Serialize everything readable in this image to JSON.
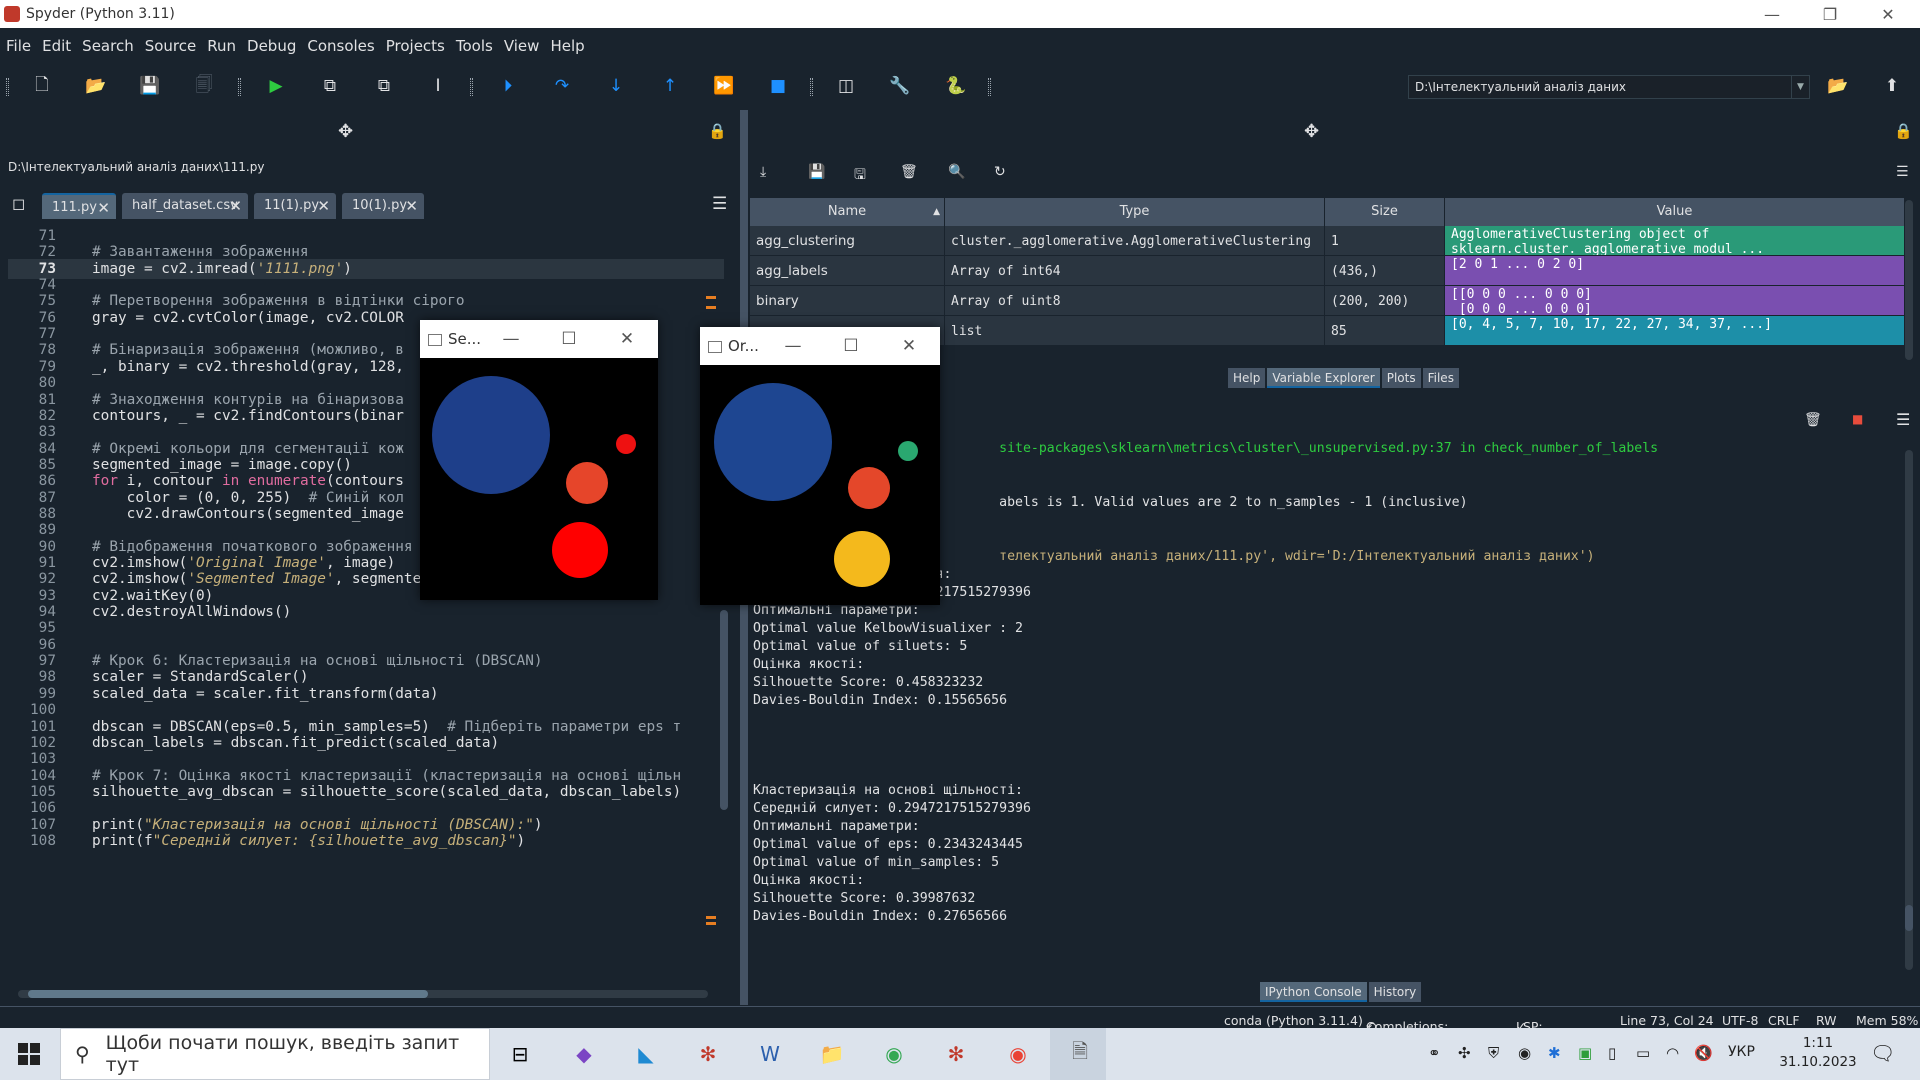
{
  "app": {
    "title": "Spyder (Python 3.11)"
  },
  "menu": [
    "File",
    "Edit",
    "Search",
    "Source",
    "Run",
    "Debug",
    "Consoles",
    "Projects",
    "Tools",
    "View",
    "Help"
  ],
  "toolbar": {
    "path": "D:\\Інтелектуальний аналіз даних"
  },
  "editor": {
    "file_path": "D:\\Інтелектуальний аналіз даних\\111.py",
    "tabs": [
      "111.py",
      "half_dataset.csv",
      "11(1).py",
      "10(1).py"
    ],
    "current_line": 73,
    "lines": [
      {
        "n": "71",
        "t": ""
      },
      {
        "n": "72",
        "t": "# Завантаження зображення"
      },
      {
        "n": "73",
        "t": "image = cv2.imread('1111.png')"
      },
      {
        "n": "74",
        "t": ""
      },
      {
        "n": "75",
        "t": "# Перетворення зображення в відтінки сірого"
      },
      {
        "n": "76",
        "t": "gray = cv2.cvtColor(image, cv2.COLOR"
      },
      {
        "n": "77",
        "t": ""
      },
      {
        "n": "78",
        "t": "# Бінаризація зображення (можливо, в                     ний п"
      },
      {
        "n": "79",
        "t": "_, binary = cv2.threshold(gray, 128,"
      },
      {
        "n": "80",
        "t": ""
      },
      {
        "n": "81",
        "t": "# Знаходження контурів на бінаризова"
      },
      {
        "n": "82",
        "t": "contours, _ = cv2.findContours(binar                      HAIN_"
      },
      {
        "n": "83",
        "t": ""
      },
      {
        "n": "84",
        "t": "# Окремі кольори для сегментації кож"
      },
      {
        "n": "85",
        "t": "segmented_image = image.copy()"
      },
      {
        "n": "86",
        "t": "for i, contour in enumerate(contours"
      },
      {
        "n": "87",
        "t": "    color = (0, 0, 255)  # Синій кол"
      },
      {
        "n": "88",
        "t": "    cv2.drawContours(segmented_image                      ckne"
      },
      {
        "n": "89",
        "t": ""
      },
      {
        "n": "90",
        "t": "# Відображення початкового зображення та зображення сегментації"
      },
      {
        "n": "91",
        "t": "cv2.imshow('Original Image', image)"
      },
      {
        "n": "92",
        "t": "cv2.imshow('Segmented Image', segmented_image)"
      },
      {
        "n": "93",
        "t": "cv2.waitKey(0)"
      },
      {
        "n": "94",
        "t": "cv2.destroyAllWindows()"
      },
      {
        "n": "95",
        "t": ""
      },
      {
        "n": "96",
        "t": ""
      },
      {
        "n": "97",
        "t": "# Крок 6: Кластеризація на основі щільності (DBSCAN)"
      },
      {
        "n": "98",
        "t": "scaler = StandardScaler()"
      },
      {
        "n": "99",
        "t": "scaled_data = scaler.fit_transform(data)"
      },
      {
        "n": "100",
        "t": ""
      },
      {
        "n": "101",
        "t": "dbscan = DBSCAN(eps=0.5, min_samples=5)  # Підберіть параметри eps т"
      },
      {
        "n": "102",
        "t": "dbscan_labels = dbscan.fit_predict(scaled_data)"
      },
      {
        "n": "103",
        "t": ""
      },
      {
        "n": "104",
        "t": "# Крок 7: Оцінка якості кластеризації (кластеризація на основі щільн"
      },
      {
        "n": "105",
        "t": "silhouette_avg_dbscan = silhouette_score(scaled_data, dbscan_labels)"
      },
      {
        "n": "106",
        "t": ""
      },
      {
        "n": "107",
        "t": "print(\"Кластеризація на основі щільності (DBSCAN):\")"
      },
      {
        "n": "108",
        "t": "print(f\"Середній силует: {silhouette_avg_dbscan}\")"
      }
    ]
  },
  "variable_explorer": {
    "columns": [
      "Name",
      "Type",
      "Size",
      "Value"
    ],
    "rows": [
      {
        "name": "agg_clustering",
        "type": "cluster._agglomerative.AgglomerativeClustering",
        "size": "1",
        "value": "AgglomerativeClustering object of\nsklearn.cluster._agglomerative modul ...",
        "color": "#2a9a78"
      },
      {
        "name": "agg_labels",
        "type": "Array of int64",
        "size": "(436,)",
        "value": "[2 0 1 ... 0 2 0]",
        "color": "#7a4fb0"
      },
      {
        "name": "binary",
        "type": "Array of uint8",
        "size": "(200, 200)",
        "value": "[[0 0 0 ... 0 0 0]\n [0 0 0 ... 0 0 0]",
        "color": "#7a4fb0"
      },
      {
        "name": "",
        "type": "list",
        "size": "85",
        "value": "[0, 4, 5, 7, 10, 17, 22, 27, 34, 37, ...]",
        "color": "#1d8fa8"
      }
    ],
    "tabs": [
      "Help",
      "Variable Explorer",
      "Plots",
      "Files"
    ]
  },
  "console": {
    "lines": [
      {
        "t": "                               site-packages\\sklearn\\metrics\\cluster\\_unsupervised.py:37 in check_number_of_labels",
        "c": "#2ecc40"
      },
      {
        "t": "",
        "c": "#e0e1e3"
      },
      {
        "t": "",
        "c": "#e0e1e3"
      },
      {
        "t": "                               abels is 1. Valid values are 2 to n_samples - 1 (inclusive)",
        "c": "#e0e1e3"
      },
      {
        "t": "",
        "c": "#e0e1e3"
      },
      {
        "t": "",
        "c": "#e0e1e3"
      },
      {
        "t": "                               телектуальний аналіз даних/111.py', wdir='D:/Інтелектуальний аналіз даних')",
        "c": "#c6b07a"
      },
      {
        "t": "Ієрархічна кластеризація:",
        "c": "#e0e1e3"
      },
      {
        "t": "Середній силует: 0.2947217515279396",
        "c": "#e0e1e3"
      },
      {
        "t": "Оптимальні параметри:",
        "c": "#e0e1e3"
      },
      {
        "t": "Optimal value KelbowVisualixer : 2",
        "c": "#e0e1e3"
      },
      {
        "t": "Optimal value of siluets: 5",
        "c": "#e0e1e3"
      },
      {
        "t": "Оцінка якості:",
        "c": "#e0e1e3"
      },
      {
        "t": "Silhouette Score: 0.458323232",
        "c": "#e0e1e3"
      },
      {
        "t": "Davies-Bouldin Index: 0.15565656",
        "c": "#e0e1e3"
      },
      {
        "t": "",
        "c": "#e0e1e3"
      },
      {
        "t": "",
        "c": "#e0e1e3"
      },
      {
        "t": "",
        "c": "#e0e1e3"
      },
      {
        "t": "",
        "c": "#e0e1e3"
      },
      {
        "t": "Кластеризація на основі щільності:",
        "c": "#e0e1e3"
      },
      {
        "t": "Середній силует: 0.2947217515279396",
        "c": "#e0e1e3"
      },
      {
        "t": "Оптимальні параметри:",
        "c": "#e0e1e3"
      },
      {
        "t": "Optimal value of eps: 0.2343243445",
        "c": "#e0e1e3"
      },
      {
        "t": "Optimal value of min_samples: 5",
        "c": "#e0e1e3"
      },
      {
        "t": "Оцінка якості:",
        "c": "#e0e1e3"
      },
      {
        "t": "Silhouette Score: 0.39987632",
        "c": "#e0e1e3"
      },
      {
        "t": "Davies-Bouldin Index: 0.27656566",
        "c": "#e0e1e3"
      }
    ],
    "tabs": [
      "IPython Console",
      "History"
    ]
  },
  "status": {
    "env": "conda (Python 3.11.4)",
    "completions": "Completions: conda",
    "lsp": "LSP: Python",
    "pos": "Line 73, Col 24",
    "enc": "UTF-8",
    "eol": "CRLF",
    "rw": "RW",
    "mem": "Mem 58%"
  },
  "windows": {
    "segmented_title": "Se...",
    "original_title": "Or..."
  },
  "taskbar": {
    "search_placeholder": "Щоби почати пошук, введіть запит тут",
    "lang": "УКР",
    "time": "1:11",
    "date": "31.10.2023"
  }
}
